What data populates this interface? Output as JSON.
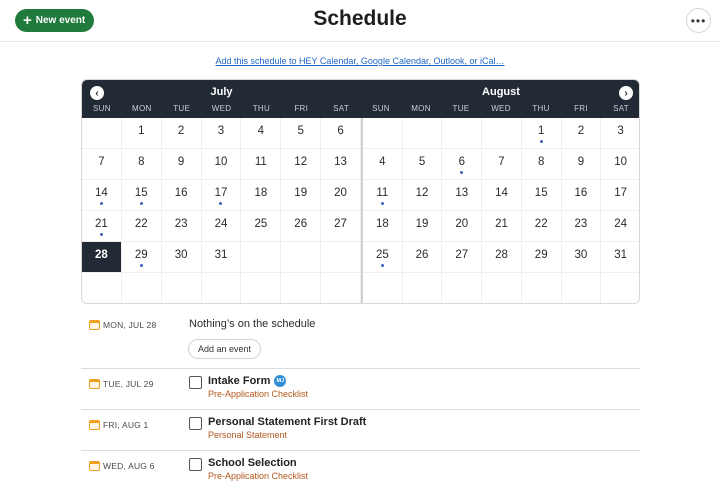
{
  "header": {
    "new_event_label": "New event",
    "title": "Schedule",
    "menu_icon": "•••"
  },
  "sync_link": "Add this schedule to HEY Calendar, Google Calendar, Outlook, or iCal…",
  "calendar": {
    "weekdays": [
      "SUN",
      "MON",
      "TUE",
      "WED",
      "THU",
      "FRI",
      "SAT"
    ],
    "prev_icon": "‹",
    "next_icon": "›",
    "months": [
      {
        "name": "July",
        "first_weekday": 1,
        "days": 31,
        "selected_day": 28,
        "event_days": [
          14,
          15,
          17,
          21,
          29
        ]
      },
      {
        "name": "August",
        "first_weekday": 4,
        "days": 31,
        "selected_day": null,
        "event_days": [
          1,
          6,
          11,
          25
        ]
      }
    ],
    "colors": {
      "header_bg": "#222a35",
      "event_dot": "#3a66b8"
    }
  },
  "agenda": {
    "empty_day": {
      "date": "MON, JUL 28",
      "message": "Nothing’s on the schedule",
      "add_button": "Add an event"
    },
    "items": [
      {
        "date": "TUE, JUL 29",
        "title": "Intake Form",
        "avatar": "MJ",
        "subtitle": "Pre-Application Checklist"
      },
      {
        "date": "FRI, AUG 1",
        "title": "Personal Statement First Draft",
        "subtitle": "Personal Statement"
      },
      {
        "date": "WED, AUG 6",
        "title": "School Selection",
        "subtitle": "Pre-Application Checklist"
      }
    ]
  }
}
